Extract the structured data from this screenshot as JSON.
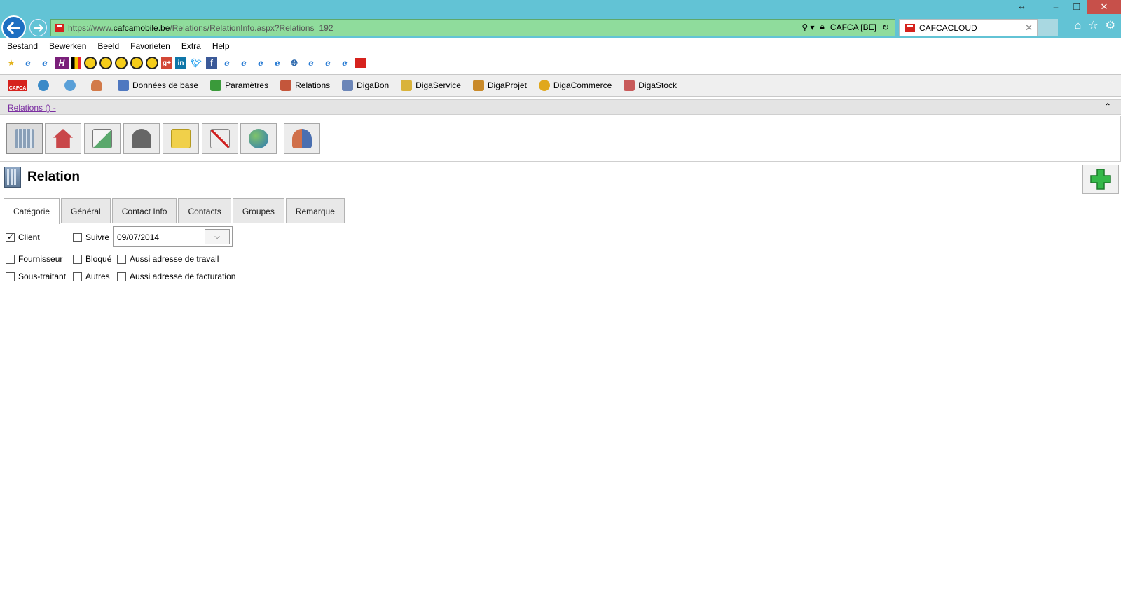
{
  "browser": {
    "url_scheme": "https://www.",
    "url_host": "cafcamobile.be",
    "url_path": "/Relations/RelationInfo.aspx?Relations=192",
    "site_identity": "CAFCA [BE]",
    "tab_title": "CAFCACLOUD",
    "accent": "#62c3d5"
  },
  "menu": [
    "Bestand",
    "Bewerken",
    "Beeld",
    "Favorieten",
    "Extra",
    "Help"
  ],
  "favorites_icons": [
    "star-icon",
    "ie-icon",
    "ie-icon",
    "h-icon",
    "flag-icon",
    "yellow-icon",
    "yellow-icon",
    "yellow-icon",
    "yellow-icon",
    "yellow-icon",
    "google-plus-icon",
    "linkedin-icon",
    "twitter-icon",
    "facebook-icon",
    "ie-icon",
    "ie-icon",
    "ie-icon",
    "ie-icon",
    "globe-icon",
    "ie-icon",
    "ie-icon",
    "ie-icon",
    "cafca-icon"
  ],
  "app_toolbar": {
    "logo_text": "CAFCA",
    "items": [
      {
        "label": "Données de base",
        "color": "#4f78c0"
      },
      {
        "label": "Paramètres",
        "color": "#3a9a3a"
      },
      {
        "label": "Relations",
        "color": "#c4563b"
      },
      {
        "label": "DigaBon",
        "color": "#6c86b8"
      },
      {
        "label": "DigaService",
        "color": "#d9b33b"
      },
      {
        "label": "DigaProjet",
        "color": "#c98a2a"
      },
      {
        "label": "DigaCommerce",
        "color": "#e0a81d"
      },
      {
        "label": "DigaStock",
        "color": "#c85a5a"
      }
    ]
  },
  "section": {
    "link": "Relations () -",
    "collapse_icon": "chevron-up-icon"
  },
  "icon_buttons": [
    {
      "name": "building-icon",
      "color": "#8aa0b8"
    },
    {
      "name": "house-icon",
      "color": "#c9474a"
    },
    {
      "name": "mail-icon",
      "color": "#5aa86c"
    },
    {
      "name": "contact-person-icon",
      "color": "#666666"
    },
    {
      "name": "folder-icon",
      "color": "#f0d04a"
    },
    {
      "name": "document-cancel-icon",
      "color": "#b9b9b9"
    },
    {
      "name": "globe-icon",
      "color": "#2d78b8"
    },
    {
      "name": "users-icon",
      "color": "#d0704a"
    }
  ],
  "relation": {
    "title": "Relation",
    "add_icon": "plus-icon"
  },
  "tabs": [
    "Catégorie",
    "Général",
    "Contact Info",
    "Contacts",
    "Groupes",
    "Remarque"
  ],
  "category": {
    "client": {
      "label": "Client",
      "checked": true
    },
    "suivre": {
      "label": "Suivre",
      "checked": false
    },
    "date": "09/07/2014",
    "fournisseur": {
      "label": "Fournisseur",
      "checked": false
    },
    "bloque": {
      "label": "Bloqué",
      "checked": false
    },
    "travail": {
      "label": "Aussi adresse de travail",
      "checked": false
    },
    "sous_traitant": {
      "label": "Sous-traitant",
      "checked": false
    },
    "autres": {
      "label": "Autres",
      "checked": false
    },
    "facturation": {
      "label": "Aussi adresse de facturation",
      "checked": false
    }
  }
}
